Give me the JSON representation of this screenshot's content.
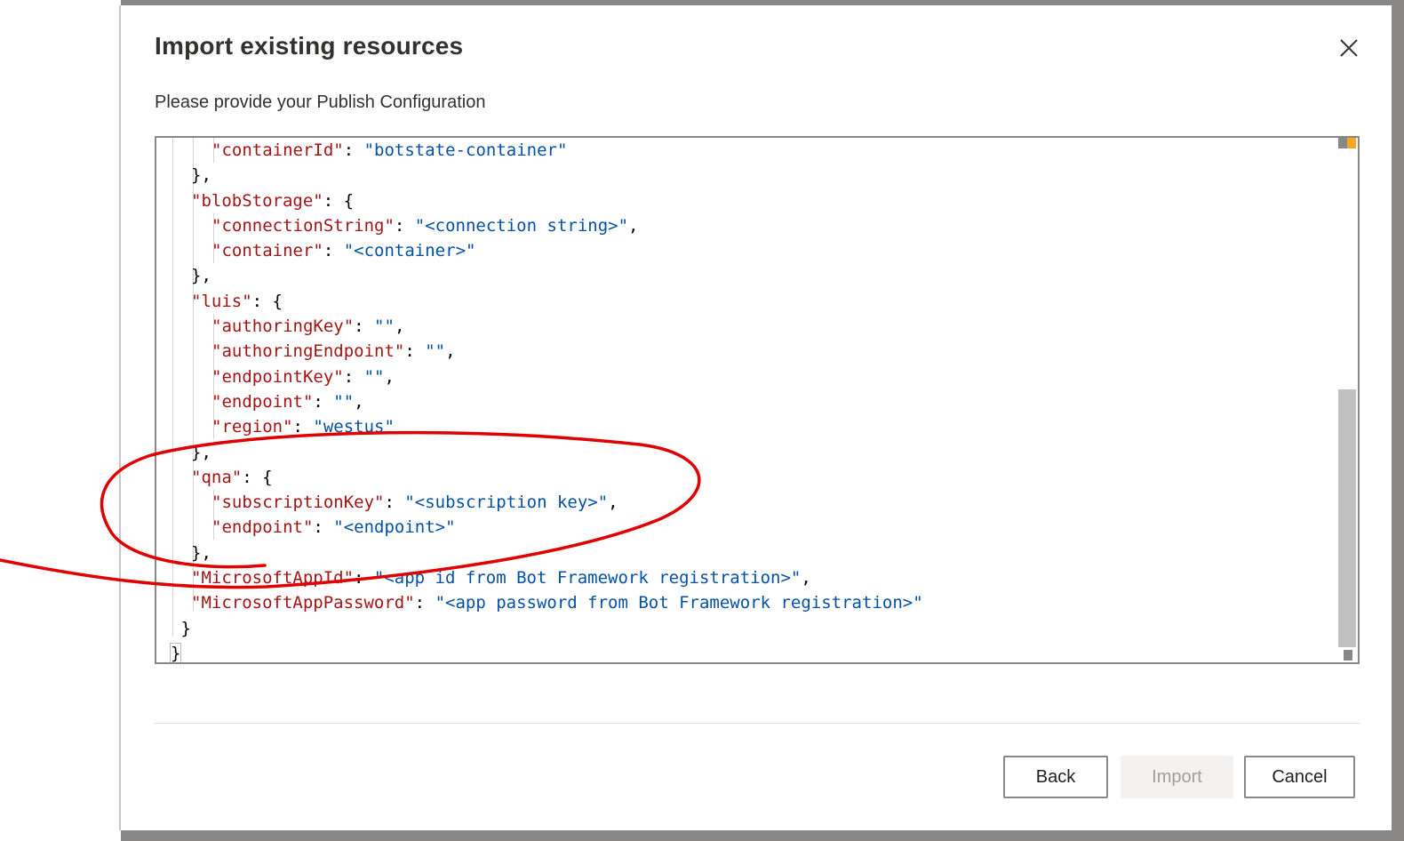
{
  "dialog": {
    "title": "Import existing resources",
    "subtitle": "Please provide your Publish Configuration",
    "close_icon": "close-icon"
  },
  "editor": {
    "lines": [
      {
        "indent": 2,
        "parts": [
          {
            "t": "k",
            "v": "\"containerId\""
          },
          {
            "t": "p",
            "v": ": "
          },
          {
            "t": "s",
            "v": "\"botstate-container\""
          }
        ]
      },
      {
        "indent": 1,
        "parts": [
          {
            "t": "p",
            "v": "},"
          }
        ]
      },
      {
        "indent": 1,
        "parts": [
          {
            "t": "k",
            "v": "\"blobStorage\""
          },
          {
            "t": "p",
            "v": ": {"
          }
        ]
      },
      {
        "indent": 2,
        "parts": [
          {
            "t": "k",
            "v": "\"connectionString\""
          },
          {
            "t": "p",
            "v": ": "
          },
          {
            "t": "s",
            "v": "\"<connection string>\""
          },
          {
            "t": "p",
            "v": ","
          }
        ]
      },
      {
        "indent": 2,
        "parts": [
          {
            "t": "k",
            "v": "\"container\""
          },
          {
            "t": "p",
            "v": ": "
          },
          {
            "t": "s",
            "v": "\"<container>\""
          }
        ]
      },
      {
        "indent": 1,
        "parts": [
          {
            "t": "p",
            "v": "},"
          }
        ]
      },
      {
        "indent": 1,
        "parts": [
          {
            "t": "k",
            "v": "\"luis\""
          },
          {
            "t": "p",
            "v": ": {"
          }
        ]
      },
      {
        "indent": 2,
        "parts": [
          {
            "t": "k",
            "v": "\"authoringKey\""
          },
          {
            "t": "p",
            "v": ": "
          },
          {
            "t": "s",
            "v": "\"\""
          },
          {
            "t": "p",
            "v": ","
          }
        ]
      },
      {
        "indent": 2,
        "parts": [
          {
            "t": "k",
            "v": "\"authoringEndpoint\""
          },
          {
            "t": "p",
            "v": ": "
          },
          {
            "t": "s",
            "v": "\"\""
          },
          {
            "t": "p",
            "v": ","
          }
        ]
      },
      {
        "indent": 2,
        "parts": [
          {
            "t": "k",
            "v": "\"endpointKey\""
          },
          {
            "t": "p",
            "v": ": "
          },
          {
            "t": "s",
            "v": "\"\""
          },
          {
            "t": "p",
            "v": ","
          }
        ]
      },
      {
        "indent": 2,
        "parts": [
          {
            "t": "k",
            "v": "\"endpoint\""
          },
          {
            "t": "p",
            "v": ": "
          },
          {
            "t": "s",
            "v": "\"\""
          },
          {
            "t": "p",
            "v": ","
          }
        ]
      },
      {
        "indent": 2,
        "parts": [
          {
            "t": "k",
            "v": "\"region\""
          },
          {
            "t": "p",
            "v": ": "
          },
          {
            "t": "s",
            "v": "\"westus\""
          }
        ]
      },
      {
        "indent": 1,
        "parts": [
          {
            "t": "p",
            "v": "},"
          }
        ]
      },
      {
        "indent": 1,
        "parts": [
          {
            "t": "k",
            "v": "\"qna\""
          },
          {
            "t": "p",
            "v": ": {"
          }
        ]
      },
      {
        "indent": 2,
        "parts": [
          {
            "t": "k",
            "v": "\"subscriptionKey\""
          },
          {
            "t": "p",
            "v": ": "
          },
          {
            "t": "s",
            "v": "\"<subscription key>\""
          },
          {
            "t": "p",
            "v": ","
          }
        ]
      },
      {
        "indent": 2,
        "parts": [
          {
            "t": "k",
            "v": "\"endpoint\""
          },
          {
            "t": "p",
            "v": ": "
          },
          {
            "t": "s",
            "v": "\"<endpoint>\""
          }
        ]
      },
      {
        "indent": 1,
        "parts": [
          {
            "t": "p",
            "v": "},"
          }
        ]
      },
      {
        "indent": 1,
        "parts": [
          {
            "t": "k",
            "v": "\"MicrosoftAppId\""
          },
          {
            "t": "p",
            "v": ": "
          },
          {
            "t": "s",
            "v": "\"<app id from Bot Framework registration>\""
          },
          {
            "t": "p",
            "v": ","
          }
        ]
      },
      {
        "indent": 1,
        "parts": [
          {
            "t": "k",
            "v": "\"MicrosoftAppPassword\""
          },
          {
            "t": "p",
            "v": ": "
          },
          {
            "t": "s",
            "v": "\"<app password from Bot Framework registration>\""
          }
        ]
      },
      {
        "indent": 0.5,
        "parts": [
          {
            "t": "p",
            "v": "}"
          }
        ]
      },
      {
        "indent": 0,
        "parts": [
          {
            "t": "p",
            "v": "}",
            "cursor": true
          }
        ]
      }
    ]
  },
  "buttons": {
    "back": "Back",
    "import": "Import",
    "cancel": "Cancel"
  },
  "colors": {
    "key": "#a31515",
    "string": "#0451a5",
    "annotation": "#e00000"
  }
}
